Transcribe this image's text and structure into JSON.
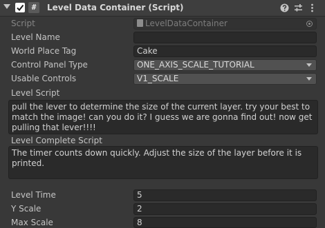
{
  "header": {
    "title": "Level Data Container (Script)",
    "icons": [
      "foldout-arrow-icon",
      "enabled-checkbox-icon",
      "script-icon",
      "help-icon",
      "preset-icon",
      "context-menu-icon"
    ],
    "script_icon_glyph": "#"
  },
  "fields": {
    "script": {
      "label": "Script",
      "value": "LevelDataContainer"
    },
    "level_name": {
      "label": "Level Name",
      "value": ""
    },
    "world_place_tag": {
      "label": "World Place Tag",
      "value": "Cake"
    },
    "control_panel_type": {
      "label": "Control Panel Type",
      "value": "ONE_AXIS_SCALE_TUTORIAL"
    },
    "usable_controls": {
      "label": "Usable Controls",
      "value": "V1_SCALE"
    },
    "level_script": {
      "label": "Level Script",
      "value": "pull the lever to determine the size of the current layer. try your best to match the image! can you do it? I guess we are gonna find out! now get pulling that lever!!!!"
    },
    "level_complete_script": {
      "label": "Level Complete Script",
      "value": "The timer counts down quickly. Adjust the size of the layer before it is printed."
    },
    "level_time": {
      "label": "Level Time",
      "value": "5"
    },
    "y_scale": {
      "label": "Y Scale",
      "value": "2"
    },
    "max_scale": {
      "label": "Max Scale",
      "value": "8"
    }
  },
  "colors": {
    "background": "#383838",
    "header": "#3e3e3e",
    "field": "#2a2a2a",
    "dropdown": "#515151",
    "text": "#c4c4c4"
  }
}
